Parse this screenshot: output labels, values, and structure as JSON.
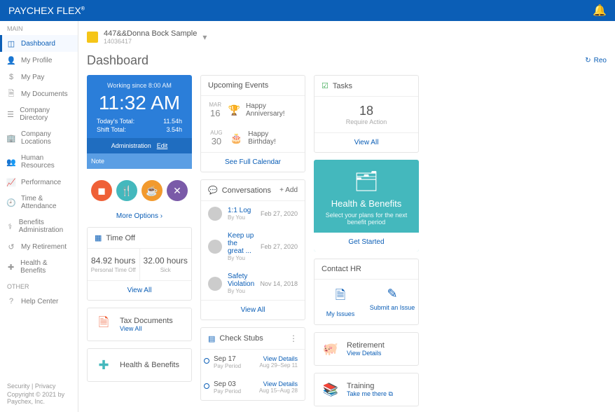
{
  "brand": {
    "name": "PAYCHEX",
    "suffix": "FLEX"
  },
  "account": {
    "name": "447&&Donna Bock Sample",
    "id": "14036417"
  },
  "page": {
    "title": "Dashboard",
    "reload": "Reo"
  },
  "nav": {
    "main_label": "MAIN",
    "other_label": "OTHER",
    "items": [
      {
        "label": "Dashboard",
        "icon": "◫"
      },
      {
        "label": "My Profile",
        "icon": "👤"
      },
      {
        "label": "My Pay",
        "icon": "$"
      },
      {
        "label": "My Documents",
        "icon": "🗎"
      },
      {
        "label": "Company Directory",
        "icon": "☰"
      },
      {
        "label": "Company Locations",
        "icon": "🏢"
      },
      {
        "label": "Human Resources",
        "icon": "👥"
      },
      {
        "label": "Performance",
        "icon": "📈"
      },
      {
        "label": "Time & Attendance",
        "icon": "🕘"
      },
      {
        "label": "Benefits Administration",
        "icon": "⚕"
      },
      {
        "label": "My Retirement",
        "icon": "↺"
      },
      {
        "label": "Health & Benefits",
        "icon": "✚"
      }
    ],
    "other": [
      {
        "label": "Help Center",
        "icon": "?"
      }
    ]
  },
  "footer": {
    "links": "Security | Privacy",
    "copyright": "Copyright © 2021 by Paychex, Inc."
  },
  "timecard": {
    "since": "Working since 8:00 AM",
    "time": "11:32 AM",
    "today_label": "Today's Total:",
    "today_val": "11.54h",
    "shift_label": "Shift Total:",
    "shift_val": "3.54h",
    "admin": "Administration",
    "edit": "Edit",
    "note": "Note",
    "more": "More Options ›"
  },
  "events": {
    "title": "Upcoming Events",
    "items": [
      {
        "mon": "MAR",
        "day": "16",
        "icon": "🏆",
        "text": "Happy Anniversary!"
      },
      {
        "mon": "AUG",
        "day": "30",
        "icon": "🎂",
        "text": "Happy Birthday!"
      }
    ],
    "link": "See Full Calendar"
  },
  "tasks": {
    "title": "Tasks",
    "count": "18",
    "sub": "Require Action",
    "link": "View All"
  },
  "conversations": {
    "title": "Conversations",
    "add": "+  Add",
    "items": [
      {
        "title": "1:1 Log",
        "by": "By You",
        "date": "Feb 27, 2020"
      },
      {
        "title": "Keep up the great ...",
        "by": "By You",
        "date": "Feb 27, 2020"
      },
      {
        "title": "Safety Violation",
        "by": "By You",
        "date": "Nov 14, 2018"
      }
    ],
    "link": "View All"
  },
  "timeoff": {
    "title": "Time Off",
    "a_val": "84.92 hours",
    "a_lbl": "Personal Time Off",
    "b_val": "32.00 hours",
    "b_lbl": "Sick",
    "link": "View All"
  },
  "rows": {
    "taxdocs": {
      "title": "Tax Documents",
      "link": "View All"
    },
    "hb": {
      "title": "Health & Benefits"
    }
  },
  "promo": {
    "title": "Health & Benefits",
    "sub": "Select your plans for the next benefit period",
    "cta": "Get Started"
  },
  "stubs": {
    "title": "Check Stubs",
    "items": [
      {
        "date": "Sep 17",
        "period": "Pay Period",
        "link": "View Details",
        "range": "Aug 29–Sep 11"
      },
      {
        "date": "Sep 03",
        "period": "Pay Period",
        "link": "View Details",
        "range": "Aug 15–Aug 28"
      }
    ]
  },
  "contacthr": {
    "title": "Contact HR",
    "a": "My Issues",
    "b": "Submit an Issue"
  },
  "retirement": {
    "title": "Retirement",
    "link": "View Details"
  },
  "training": {
    "title": "Training",
    "link": "Take me there ⧉"
  }
}
